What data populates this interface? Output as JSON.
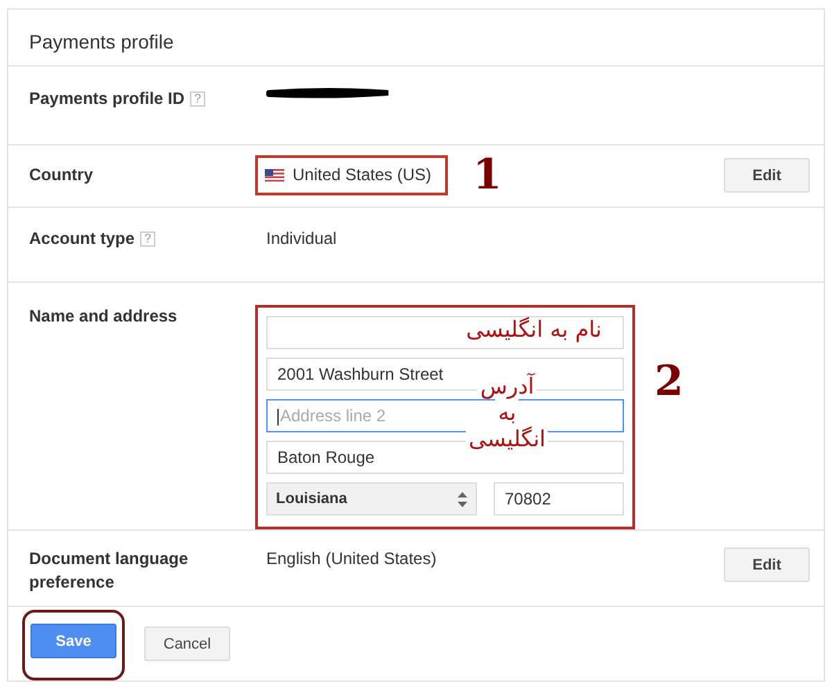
{
  "title": "Payments profile",
  "rows": [
    {
      "kind": "redacted",
      "label": "Payments profile ID",
      "help": "?"
    },
    {
      "kind": "country",
      "label": "Country",
      "value": "United States (US)",
      "edit": "Edit",
      "marker": "1"
    },
    {
      "kind": "text",
      "label": "Account type",
      "help": "?",
      "value": "Individual"
    },
    {
      "kind": "address",
      "label": "Name and address",
      "marker": "2",
      "name_note": "نام به انگلیسی",
      "address_note": [
        "آدرس",
        "به",
        "انگلیسی"
      ],
      "fields": [
        {
          "focused": false
        },
        {
          "value": "2001 Washburn Street",
          "focused": false
        },
        {
          "placeholder": "Address line 2",
          "focused": true
        },
        {
          "value": "Baton Rouge",
          "focused": false
        }
      ],
      "state": "Louisiana",
      "zip": "70802"
    },
    {
      "kind": "text",
      "label": "Document language preference",
      "value": "English (United States)",
      "edit": "Edit"
    }
  ],
  "buttons": [
    {
      "label": "Save",
      "kind": "primary",
      "circled": true
    },
    {
      "label": "Cancel",
      "kind": "secondary",
      "circled": false
    }
  ]
}
